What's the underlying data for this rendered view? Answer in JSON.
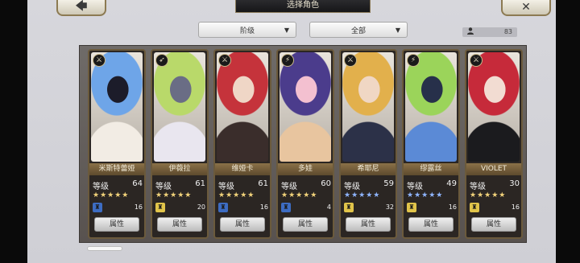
{
  "header": {
    "title": "选择角色",
    "back_icon": "🡄",
    "close_icon": "✕"
  },
  "filters": {
    "rank_label": "阶级",
    "all_label": "全部",
    "dropdown_arrow": "▼"
  },
  "roster_count": "83",
  "card_button_label": "属性",
  "level_label": "等级",
  "characters": [
    {
      "name": "米斯特蕾娅",
      "level": "64",
      "count": "16",
      "stars": "★★★★★",
      "star_color": "#f1d27a",
      "badge": "♜",
      "badge_color": "#3d6cc2",
      "role": "⚔",
      "colors": [
        "#6ea5e8",
        "#f2ece4",
        "#1c1c2a"
      ]
    },
    {
      "name": "伊薇拉",
      "level": "61",
      "count": "20",
      "stars": "★★★★★",
      "star_color": "#f1d27a",
      "badge": "♜",
      "badge_color": "#e1c44a",
      "role": "➶",
      "colors": [
        "#b9d96a",
        "#e9e6ef",
        "#6a6d85"
      ]
    },
    {
      "name": "维娅卡",
      "level": "61",
      "count": "16",
      "stars": "★★★★★",
      "star_color": "#f1d27a",
      "badge": "♜",
      "badge_color": "#3d6cc2",
      "role": "⚔",
      "colors": [
        "#c5333b",
        "#3a2d2b",
        "#efd6c6"
      ]
    },
    {
      "name": "多娃",
      "level": "60",
      "count": "4",
      "stars": "★★★★★",
      "star_color": "#f1d27a",
      "badge": "♜",
      "badge_color": "#3d6cc2",
      "role": "⚡",
      "colors": [
        "#4b3c8c",
        "#e8c59f",
        "#f3c0d0"
      ]
    },
    {
      "name": "希耶尼",
      "level": "59",
      "count": "32",
      "stars": "★★★★★",
      "star_color": "#8fb5ff",
      "badge": "♜",
      "badge_color": "#e1c44a",
      "role": "⚔",
      "colors": [
        "#e2b04c",
        "#2c3148",
        "#f0d7c4"
      ]
    },
    {
      "name": "缪露丝",
      "level": "49",
      "count": "16",
      "stars": "★★★★★",
      "star_color": "#8fb5ff",
      "badge": "♜",
      "badge_color": "#e1c44a",
      "role": "⚡",
      "colors": [
        "#9bd45a",
        "#5b8ad6",
        "#27304a"
      ]
    },
    {
      "name": "VIOLET",
      "level": "30",
      "count": "16",
      "stars": "★★★★★",
      "star_color": "#f1d27a",
      "badge": "♜",
      "badge_color": "#e1c44a",
      "role": "⚔",
      "colors": [
        "#c62a3a",
        "#1b1b1e",
        "#f2dcd2"
      ]
    }
  ]
}
